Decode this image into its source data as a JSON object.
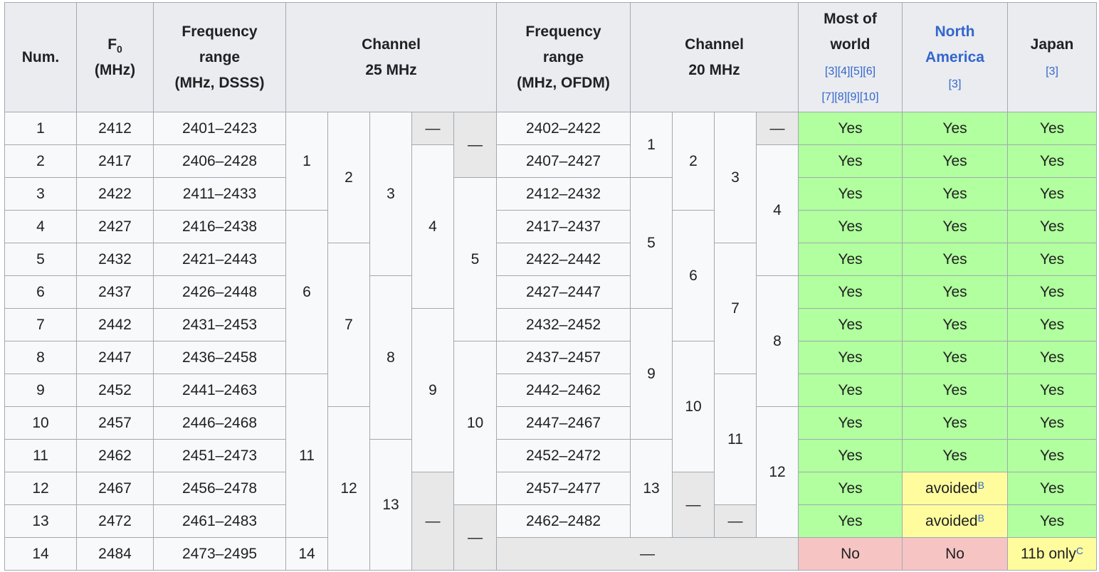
{
  "headers": {
    "num": "Num.",
    "f0_main": "F",
    "f0_sub": "0",
    "f0_unit": "(MHz)",
    "freq_dsss_1": "Frequency",
    "freq_dsss_2": "range",
    "freq_dsss_3": "(MHz, DSSS)",
    "channel25_1": "Channel",
    "channel25_2": "25 MHz",
    "freq_ofdm_1": "Frequency",
    "freq_ofdm_2": "range",
    "freq_ofdm_3": "(MHz, OFDM)",
    "channel20_1": "Channel",
    "channel20_2": "20 MHz",
    "world_1": "Most of",
    "world_2": "world",
    "world_refs_1": "[3][4][5][6]",
    "world_refs_2": "[7][8][9][10]",
    "na_1": "North",
    "na_2": "America",
    "na_ref": "[3]",
    "japan": "Japan",
    "japan_ref": "[3]"
  },
  "rows": [
    {
      "num": "1",
      "f0": "2412",
      "dsss": "2401–2423",
      "ofdm": "2402–2422",
      "world": "Yes",
      "na": "Yes",
      "japan": "Yes"
    },
    {
      "num": "2",
      "f0": "2417",
      "dsss": "2406–2428",
      "ofdm": "2407–2427",
      "world": "Yes",
      "na": "Yes",
      "japan": "Yes"
    },
    {
      "num": "3",
      "f0": "2422",
      "dsss": "2411–2433",
      "ofdm": "2412–2432",
      "world": "Yes",
      "na": "Yes",
      "japan": "Yes"
    },
    {
      "num": "4",
      "f0": "2427",
      "dsss": "2416–2438",
      "ofdm": "2417–2437",
      "world": "Yes",
      "na": "Yes",
      "japan": "Yes"
    },
    {
      "num": "5",
      "f0": "2432",
      "dsss": "2421–2443",
      "ofdm": "2422–2442",
      "world": "Yes",
      "na": "Yes",
      "japan": "Yes"
    },
    {
      "num": "6",
      "f0": "2437",
      "dsss": "2426–2448",
      "ofdm": "2427–2447",
      "world": "Yes",
      "na": "Yes",
      "japan": "Yes"
    },
    {
      "num": "7",
      "f0": "2442",
      "dsss": "2431–2453",
      "ofdm": "2432–2452",
      "world": "Yes",
      "na": "Yes",
      "japan": "Yes"
    },
    {
      "num": "8",
      "f0": "2447",
      "dsss": "2436–2458",
      "ofdm": "2437–2457",
      "world": "Yes",
      "na": "Yes",
      "japan": "Yes"
    },
    {
      "num": "9",
      "f0": "2452",
      "dsss": "2441–2463",
      "ofdm": "2442–2462",
      "world": "Yes",
      "na": "Yes",
      "japan": "Yes"
    },
    {
      "num": "10",
      "f0": "2457",
      "dsss": "2446–2468",
      "ofdm": "2447–2467",
      "world": "Yes",
      "na": "Yes",
      "japan": "Yes"
    },
    {
      "num": "11",
      "f0": "2462",
      "dsss": "2451–2473",
      "ofdm": "2452–2472",
      "world": "Yes",
      "na": "Yes",
      "japan": "Yes"
    },
    {
      "num": "12",
      "f0": "2467",
      "dsss": "2456–2478",
      "ofdm": "2457–2477",
      "world": "Yes",
      "na": "avoided",
      "na_note": "B",
      "japan": "Yes"
    },
    {
      "num": "13",
      "f0": "2472",
      "dsss": "2461–2483",
      "ofdm": "2462–2482",
      "world": "Yes",
      "na": "avoided",
      "na_note": "B",
      "japan": "Yes"
    },
    {
      "num": "14",
      "f0": "2484",
      "dsss": "2473–2495",
      "ofdm": "—",
      "world": "No",
      "na": "No",
      "japan": "11b only",
      "japan_note": "C"
    }
  ],
  "ch25": {
    "a": [
      "1",
      "6",
      "11",
      "14"
    ],
    "b": [
      "2",
      "7",
      "12"
    ],
    "c": [
      "3",
      "8",
      "13"
    ],
    "d": [
      "—",
      "4",
      "9",
      "—"
    ],
    "e": [
      "—",
      "5",
      "10",
      "—"
    ]
  },
  "ch20": {
    "a": [
      "1",
      "5",
      "9",
      "13"
    ],
    "b": [
      "2",
      "6",
      "10",
      "—"
    ],
    "c": [
      "3",
      "7",
      "11",
      "—"
    ],
    "d": [
      "—",
      "4",
      "8",
      "12"
    ]
  },
  "colors": {
    "yes": "#b1ff9e",
    "no": "#f7c4c4",
    "avoided": "#fffc9e",
    "header": "#eaecf0",
    "dash_cell": "#e8e8e8",
    "link": "#3366cc"
  }
}
